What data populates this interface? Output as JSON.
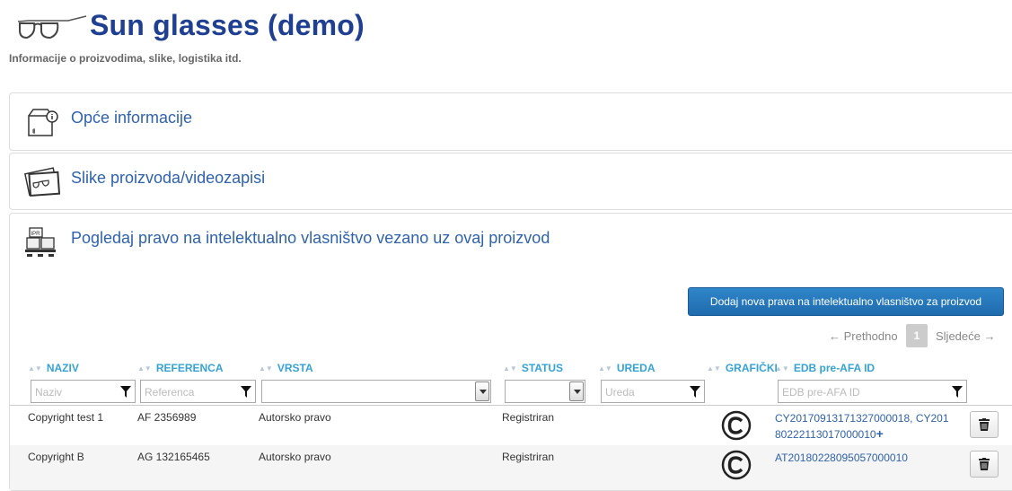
{
  "header": {
    "title": "Sun glasses (demo)",
    "subtitle": "Informacije o proizvodima, slike, logistika itd."
  },
  "panels": [
    {
      "title": "Opće informacije",
      "icon": "box-info-icon"
    },
    {
      "title": "Slike proizvoda/videozapisi",
      "icon": "product-photo-icon"
    },
    {
      "title": "Pogledaj pravo na intelektualno vlasništvo vezano uz ovaj proizvod",
      "icon": "ipr-pallet-icon"
    }
  ],
  "ipr": {
    "add_button": "Dodaj nova prava na intelektualno vlasništvo za proizvod",
    "pager": {
      "prev": "← Prethodno",
      "page": "1",
      "next": "Sljedeće →"
    },
    "columns": {
      "naziv": "NAZIV",
      "referenca": "REFERENCA",
      "vrsta": "VRSTA",
      "status": "STATUS",
      "ureda": "UREDA",
      "graficki": "GRAFIČKI",
      "edb": "EDB pre-AFA ID"
    },
    "filters": {
      "naziv": "Naziv",
      "referenca": "Referenca",
      "vrsta": "",
      "status": "",
      "ureda": "Ureda",
      "edb": "EDB pre-AFA ID"
    },
    "rows": [
      {
        "naziv": "Copyright test 1",
        "referenca": "AF 2356989",
        "vrsta": "Autorsko pravo",
        "status": "Registriran",
        "graphic": "copyright-icon",
        "edb_line1": "CY20170913171327000018, CY201",
        "edb_line2": "80222113017000010",
        "edb_more": "+"
      },
      {
        "naziv": "Copyright B",
        "referenca": "AG 132165465",
        "vrsta": "Autorsko pravo",
        "status": "Registriran",
        "graphic": "copyright-icon",
        "edb_line1": "AT20180228095057000010"
      }
    ]
  },
  "colors": {
    "title": "#1f3f93",
    "link": "#2f63ad",
    "header_col": "#35a3d5",
    "button": "#1f6bae"
  }
}
